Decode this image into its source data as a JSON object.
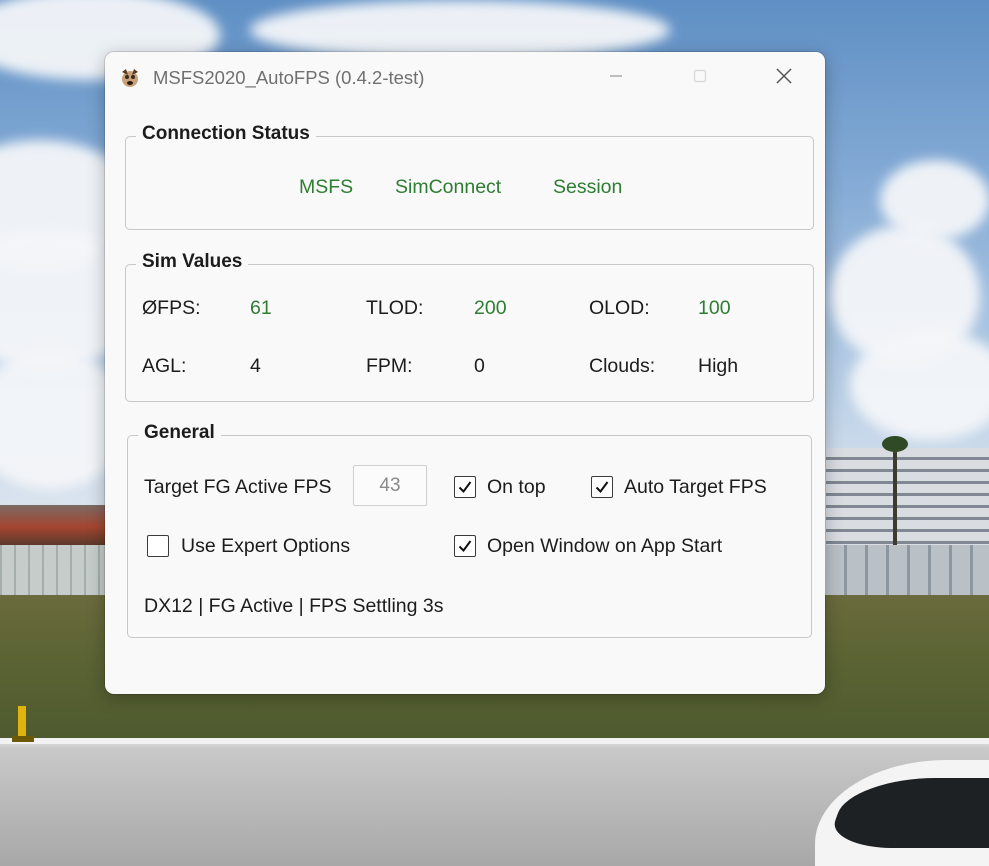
{
  "window": {
    "title": "MSFS2020_AutoFPS (0.4.2-test)"
  },
  "connection": {
    "group_label": "Connection Status",
    "items": [
      "MSFS",
      "SimConnect",
      "Session"
    ]
  },
  "sim_values": {
    "group_label": "Sim Values",
    "rows": [
      [
        {
          "label": "ØFPS:",
          "value": "61"
        },
        {
          "label": "TLOD:",
          "value": "200"
        },
        {
          "label": "OLOD:",
          "value": "100"
        }
      ],
      [
        {
          "label": "AGL:",
          "value": "4"
        },
        {
          "label": "FPM:",
          "value": "0"
        },
        {
          "label": "Clouds:",
          "value": "High"
        }
      ]
    ]
  },
  "general": {
    "group_label": "General",
    "target_label": "Target FG Active FPS",
    "target_value": "43",
    "on_top": {
      "label": "On top",
      "checked": true
    },
    "auto_target": {
      "label": "Auto Target FPS",
      "checked": true
    },
    "expert": {
      "label": "Use Expert Options",
      "checked": false
    },
    "open_window": {
      "label": "Open Window on App Start",
      "checked": true
    },
    "status": "DX12 | FG Active | FPS Settling 3s"
  },
  "colors": {
    "status_green": "#2e7d32",
    "text": "#1c1c1c",
    "window_bg": "#f9f9f9"
  },
  "icons": [
    "app-logo-icon",
    "minimize-icon",
    "maximize-icon",
    "close-icon",
    "checkmark-icon"
  ]
}
